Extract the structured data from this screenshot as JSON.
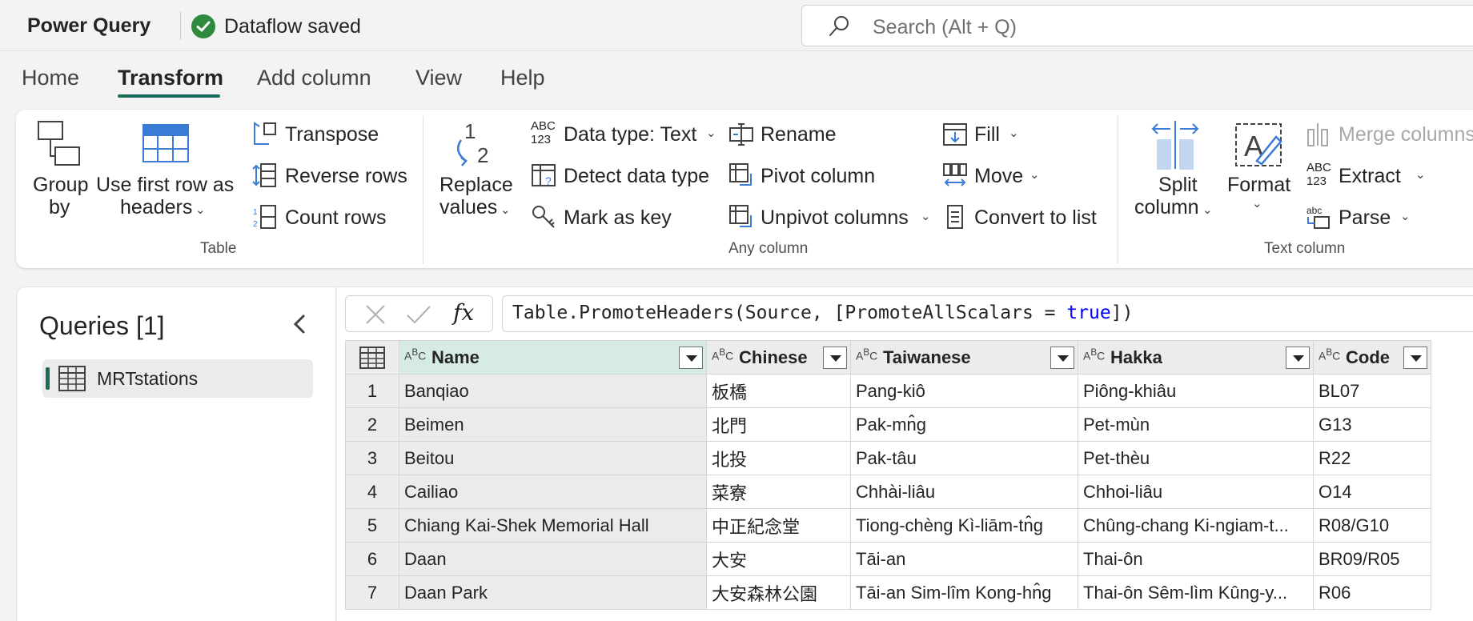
{
  "app": {
    "title": "Power Query",
    "status": "Dataflow saved"
  },
  "search": {
    "placeholder": "Search (Alt + Q)"
  },
  "tabs": [
    {
      "label": "Home"
    },
    {
      "label": "Transform"
    },
    {
      "label": "Add column"
    },
    {
      "label": "View"
    },
    {
      "label": "Help"
    }
  ],
  "ribbon": {
    "table": {
      "label": "Table",
      "group_by": [
        "Group",
        "by"
      ],
      "first_row": [
        "Use first row as",
        "headers"
      ],
      "transpose": "Transpose",
      "reverse_rows": "Reverse rows",
      "count_rows": "Count rows"
    },
    "any_column": {
      "label": "Any column",
      "replace_values": [
        "Replace",
        "values"
      ],
      "data_type": "Data type: Text",
      "detect_type": "Detect data type",
      "mark_key": "Mark as key",
      "rename": "Rename",
      "pivot": "Pivot column",
      "unpivot": "Unpivot columns",
      "fill": "Fill",
      "move": "Move",
      "convert_list": "Convert to list"
    },
    "text_column": {
      "label": "Text column",
      "split": [
        "Split",
        "column"
      ],
      "format": "Format",
      "merge": "Merge columns",
      "extract": "Extract",
      "parse": "Parse"
    }
  },
  "queries": {
    "title": "Queries [1]",
    "items": [
      {
        "label": "MRTstations"
      }
    ]
  },
  "formula": {
    "prefix": "Table.PromoteHeaders(Source, [PromoteAllScalars = ",
    "keyword": "true",
    "suffix": "])"
  },
  "grid": {
    "columns": [
      "Name",
      "Chinese",
      "Taiwanese",
      "Hakka",
      "Code"
    ],
    "rows": [
      {
        "n": "1",
        "cells": [
          "Banqiao",
          "板橋",
          "Pang-kiô",
          "Piông-khiâu",
          "BL07"
        ]
      },
      {
        "n": "2",
        "cells": [
          "Beimen",
          "北門",
          "Pak-mn̂g",
          "Pet-mùn",
          "G13"
        ]
      },
      {
        "n": "3",
        "cells": [
          "Beitou",
          "北投",
          "Pak-tâu",
          "Pet-thèu",
          "R22"
        ]
      },
      {
        "n": "4",
        "cells": [
          "Cailiao",
          "菜寮",
          "Chhài-liâu",
          "Chhoi-liâu",
          "O14"
        ]
      },
      {
        "n": "5",
        "cells": [
          "Chiang Kai-Shek Memorial Hall",
          "中正紀念堂",
          "Tiong-chèng Kì-liām-tn̂g",
          "Chûng-chang Ki-ngiam-t...",
          "R08/G10"
        ]
      },
      {
        "n": "6",
        "cells": [
          "Daan",
          "大安",
          "Tāi-an",
          "Thai-ôn",
          "BR09/R05"
        ]
      },
      {
        "n": "7",
        "cells": [
          "Daan Park",
          "大安森林公園",
          "Tāi-an Sim-lîm Kong-hn̂g",
          "Thai-ôn Sêm-lìm Kûng-y...",
          "R06"
        ]
      }
    ]
  },
  "colors": {
    "accent": "#1b6b5a",
    "saved": "#2e8b3d",
    "ribbon_icon": "#3a7bd5"
  }
}
